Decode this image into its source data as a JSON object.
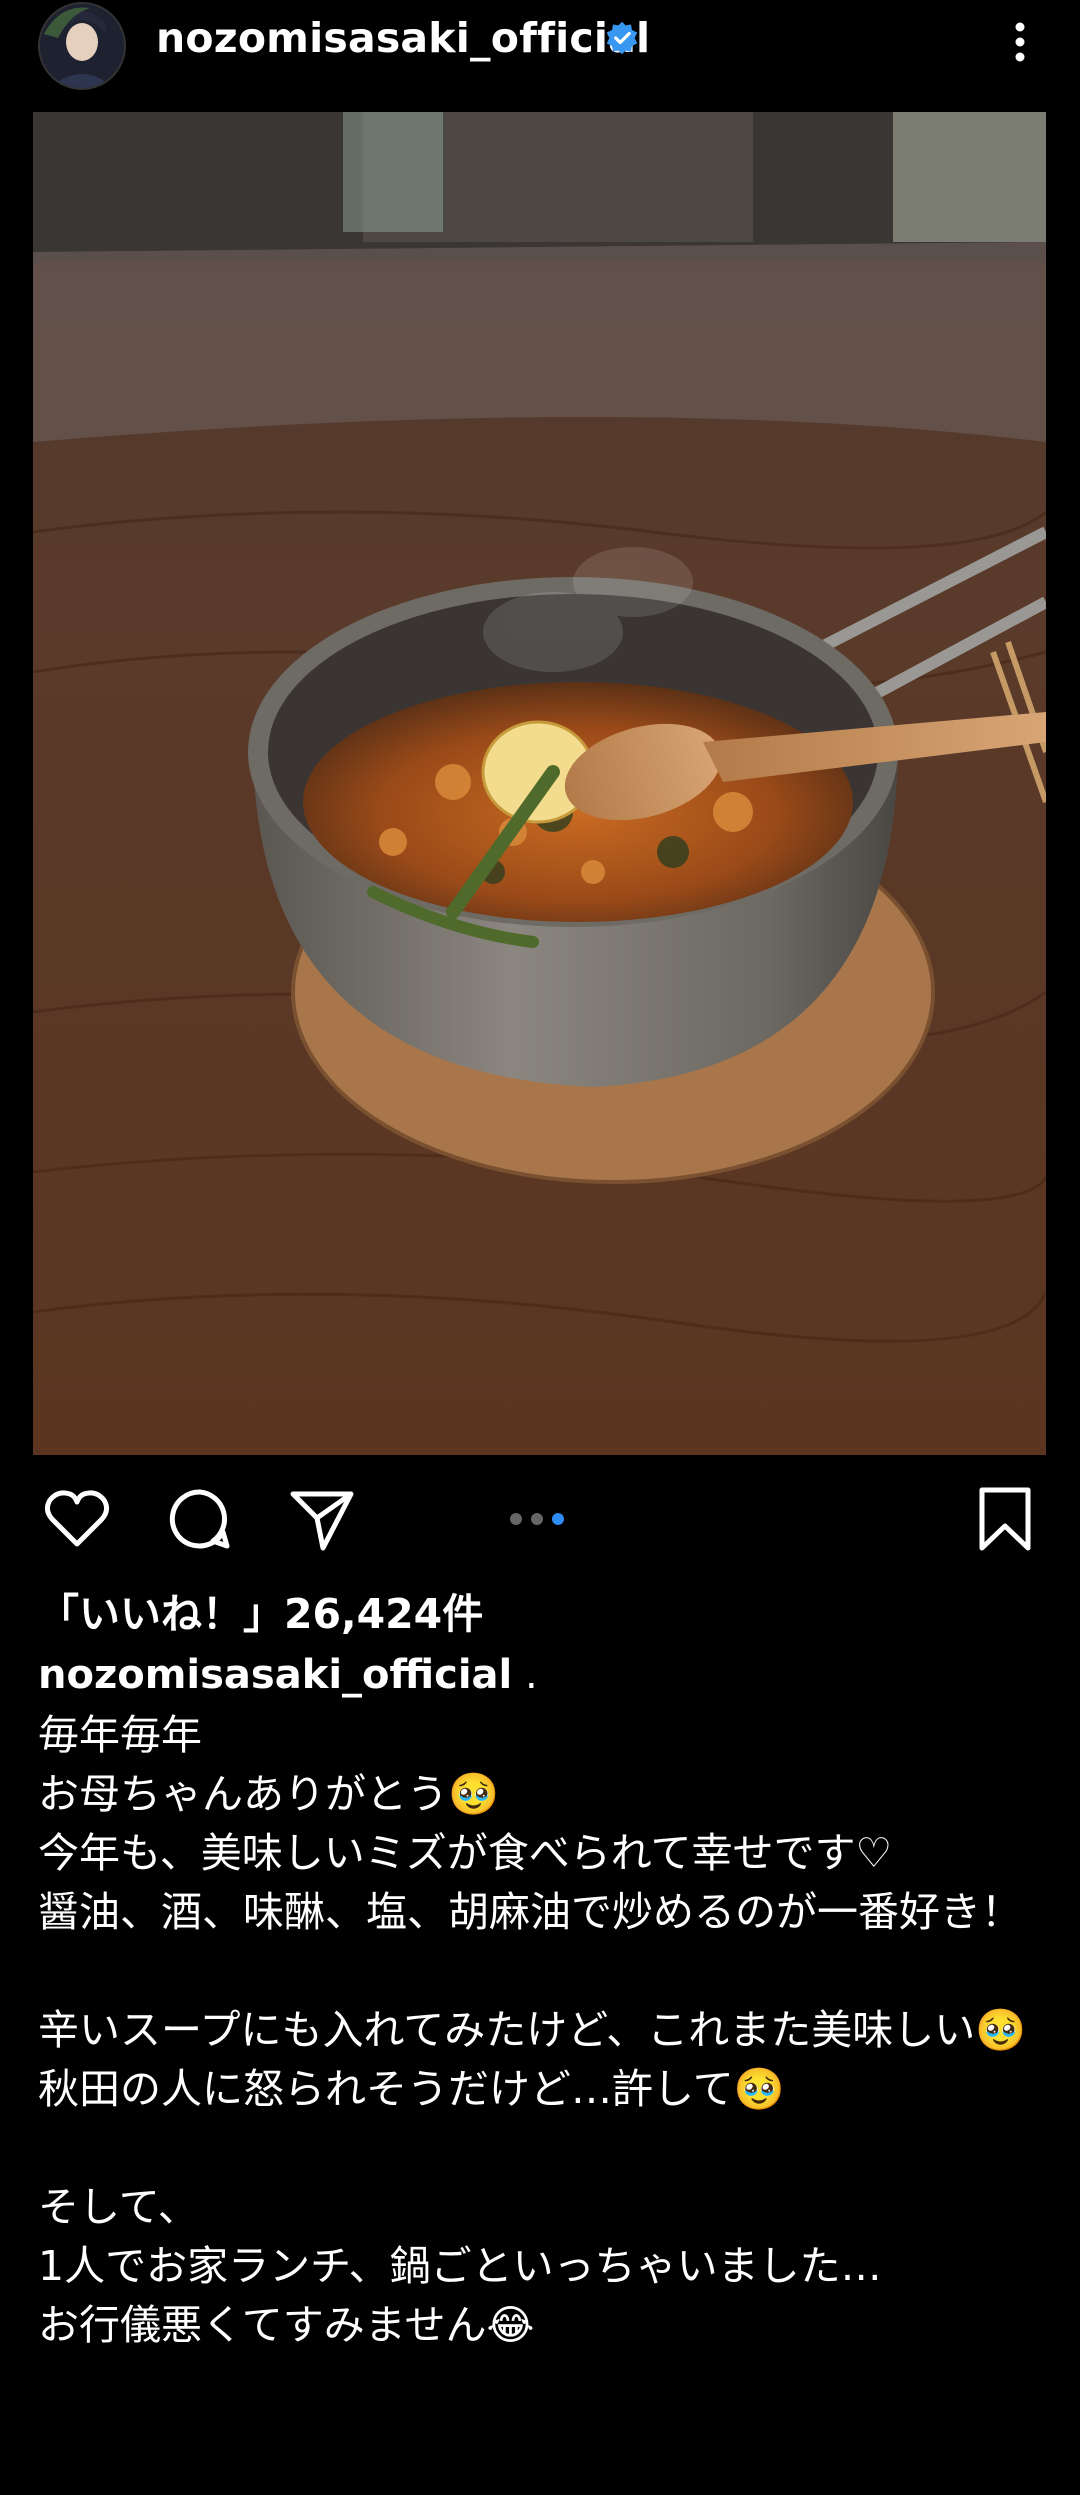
{
  "header": {
    "username": "nozomisasaki_official"
  },
  "post": {
    "likes_text": "「いいね！」26,424件",
    "caption_username": "nozomisasaki_official",
    "caption_suffix": " .",
    "caption_lines": "毎年毎年\nお母ちゃんありがとう🥹\n今年も、美味しいミズが食べられて幸せです♡\n醤油、酒、味醂、塩、胡麻油で炒めるのが一番好き！\n\n辛いスープにも入れてみたけど、これまた美味しい🥹\n秋田の人に怒られそうだけど…許して🥹\n\nそして、\n1人でお家ランチ、鍋ごといっちゃいました…\nお行儀悪くてすみません😂"
  },
  "carousel": {
    "count": 3,
    "active_index": 2
  },
  "colors": {
    "verified": "#3897f0",
    "dot_active": "#2f8cf5",
    "background": "#000000"
  },
  "icons": [
    "avatar",
    "verified-badge-icon",
    "more-options-icon",
    "heart-icon",
    "comment-icon",
    "share-icon",
    "bookmark-icon"
  ]
}
